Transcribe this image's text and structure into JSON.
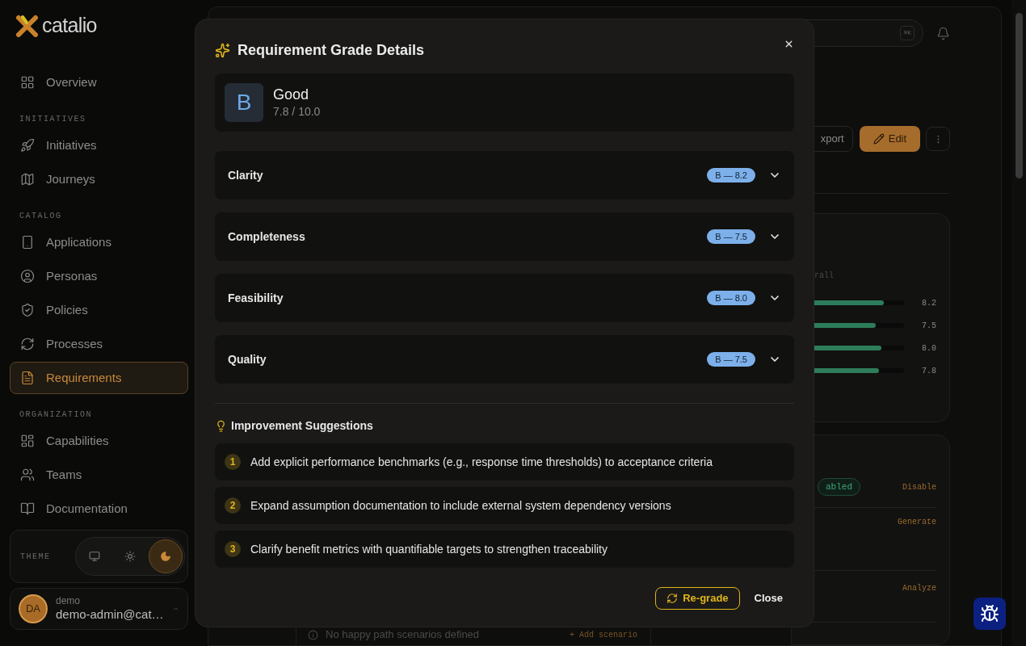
{
  "sidebar": {
    "logo": "catalio",
    "sections": [
      {
        "items": [
          {
            "label": "Overview",
            "selected": false
          }
        ]
      },
      {
        "heading": "INITIATIVES",
        "items": [
          {
            "label": "Initiatives",
            "selected": false
          },
          {
            "label": "Journeys",
            "selected": false
          }
        ]
      },
      {
        "heading": "CATALOG",
        "items": [
          {
            "label": "Applications",
            "selected": false
          },
          {
            "label": "Personas",
            "selected": false
          },
          {
            "label": "Policies",
            "selected": false
          },
          {
            "label": "Processes",
            "selected": false
          },
          {
            "label": "Requirements",
            "selected": true
          }
        ]
      },
      {
        "heading": "ORGANIZATION",
        "items": [
          {
            "label": "Capabilities",
            "selected": false
          },
          {
            "label": "Teams",
            "selected": false
          },
          {
            "label": "Documentation",
            "selected": false
          }
        ]
      }
    ],
    "theme": {
      "label": "THEME",
      "options": [
        {
          "selected": false
        },
        {
          "selected": false
        },
        {
          "selected": true
        }
      ]
    },
    "user": {
      "initials": "DA",
      "name": "demo",
      "email": "demo-admin@cat…"
    }
  },
  "header": {
    "shortcut": "⌘K",
    "export": "xport",
    "edit": "Edit"
  },
  "scores_card": {
    "label": "rall",
    "bars": [
      {
        "level": 0.82,
        "value": "8.2"
      },
      {
        "level": 0.75,
        "value": "7.5"
      },
      {
        "level": 0.8,
        "value": "8.0"
      },
      {
        "level": 0.78,
        "value": "7.8"
      }
    ]
  },
  "features_card": {
    "badge": "abled",
    "actions": [
      "Disable",
      "Generate",
      "Analyze"
    ]
  },
  "scenarios": {
    "empty": "No happy path scenarios defined",
    "add": "+ Add scenario"
  },
  "modal": {
    "title": "Requirement Grade Details",
    "grade": {
      "letter": "B",
      "label": "Good",
      "score": "7.8 / 10.0"
    },
    "criteria": [
      {
        "name": "Clarity",
        "badge": "B — 8.2",
        "expanded": false
      },
      {
        "name": "Completeness",
        "badge": "B — 7.5",
        "expanded": false
      },
      {
        "name": "Feasibility",
        "badge": "B — 8.0",
        "expanded": false
      },
      {
        "name": "Quality",
        "badge": "B — 7.5",
        "expanded": false
      }
    ],
    "suggestions_title": "Improvement Suggestions",
    "suggestions": [
      {
        "number": "1",
        "text": "Add explicit performance benchmarks (e.g., response time thresholds) to acceptance criteria"
      },
      {
        "number": "2",
        "text": "Expand assumption documentation to include external system dependency versions"
      },
      {
        "number": "3",
        "text": "Clarify benefit metrics with quantifiable targets to strengthen traceability"
      }
    ],
    "regrade": "Re-grade",
    "close": "Close"
  }
}
